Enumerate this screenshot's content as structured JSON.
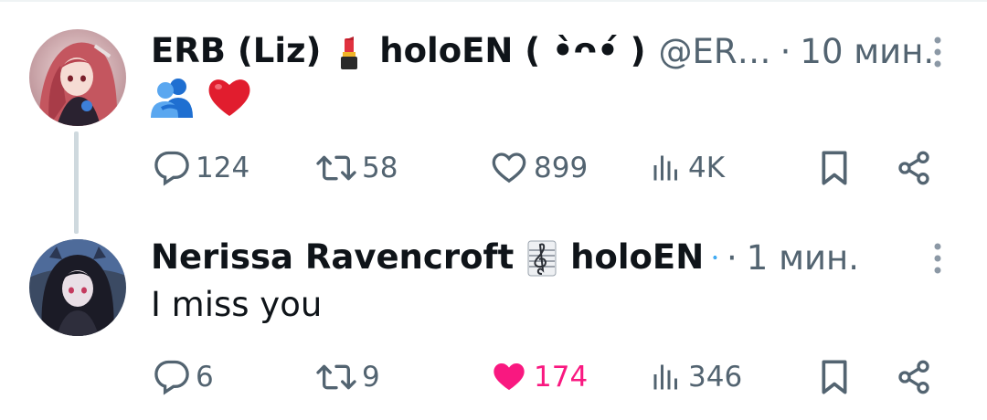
{
  "tweets": [
    {
      "display_name_part1": "ERB (Liz)",
      "display_name_part2": "holoEN ( •̀ᴖ•́ )",
      "handle": "@ER…",
      "separator": "·",
      "time": "10 мин.",
      "emojis": [
        "people-hugging-emoji",
        "red-heart-emoji"
      ],
      "actions": {
        "replies": "124",
        "reposts": "58",
        "likes": "899",
        "views": "4K"
      },
      "liked": false
    },
    {
      "display_name_part1": "Nerissa Ravencroft",
      "display_name_part2": "holoEN",
      "verified": true,
      "separator": "·",
      "time": "1 мин.",
      "text": "I miss you",
      "actions": {
        "replies": "6",
        "reposts": "9",
        "likes": "174",
        "views": "346"
      },
      "liked": true
    }
  ],
  "colors": {
    "text_primary": "#0f1419",
    "text_secondary": "#536471",
    "like_active": "#f91880",
    "verified_blue": "#1d9bf0",
    "thread_line": "#cfd9de"
  }
}
